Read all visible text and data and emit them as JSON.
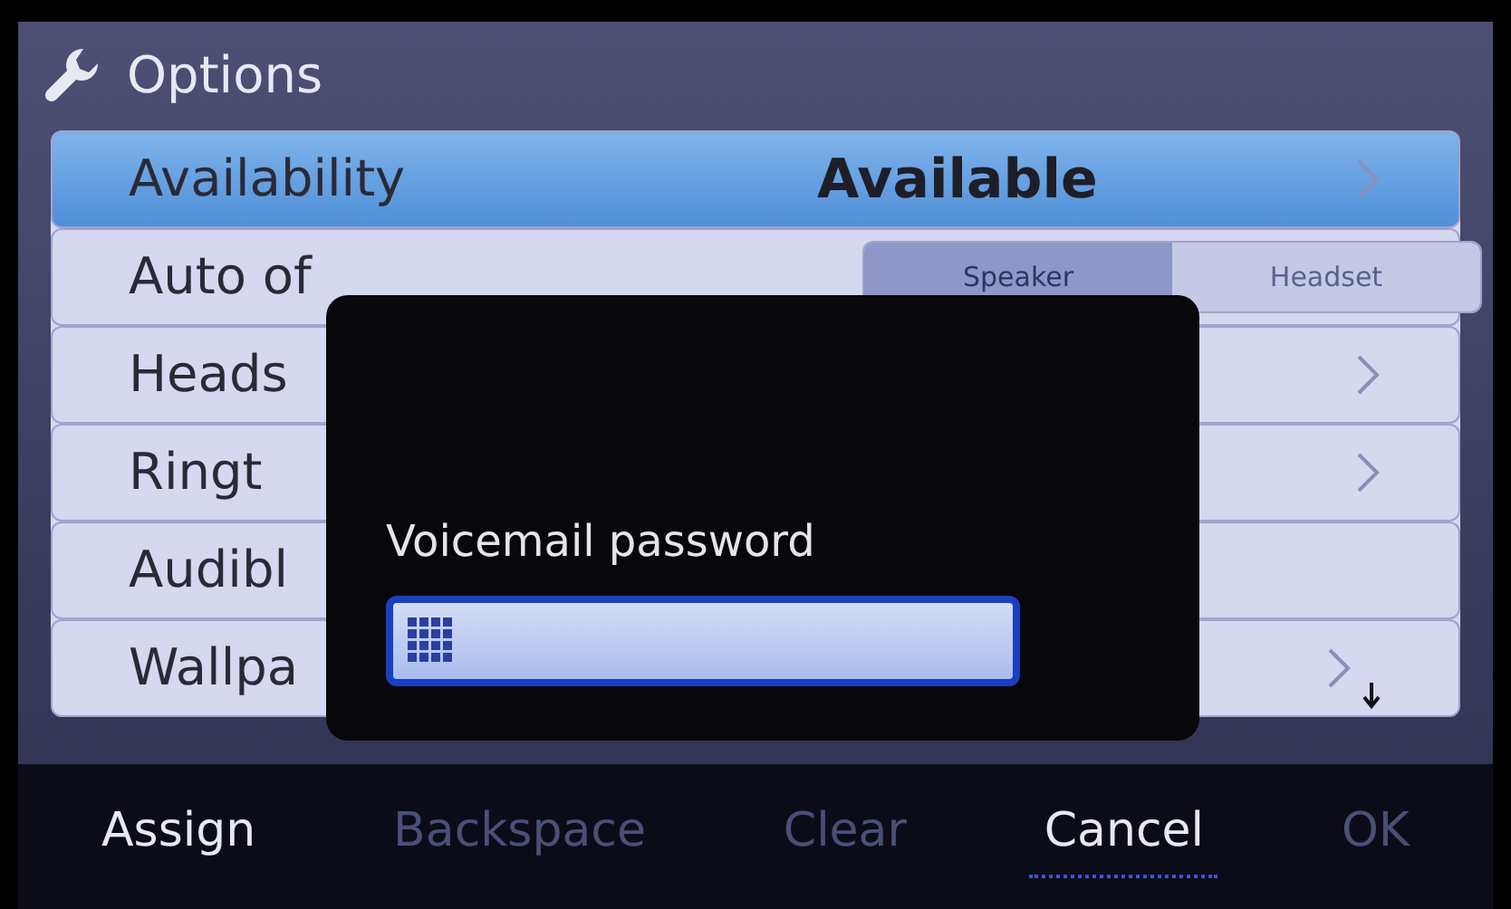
{
  "title": "Options",
  "rows": [
    {
      "label": "Availability",
      "kind": "chevron",
      "value": "Available",
      "selected": true
    },
    {
      "label": "Auto of",
      "kind": "toggle",
      "options": [
        {
          "label": "Speaker",
          "selected": true
        },
        {
          "label": "Headset",
          "selected": false
        }
      ],
      "selected": false
    },
    {
      "label": "Heads",
      "kind": "chevron",
      "selected": false
    },
    {
      "label": "Ringt",
      "kind": "chevron",
      "selected": false
    },
    {
      "label": "Audibl",
      "kind": "plain",
      "selected": false
    },
    {
      "label": "Wallpa",
      "kind": "chevron",
      "selected": false,
      "more_below": true
    }
  ],
  "dialog": {
    "label": "Voicemail password"
  },
  "softkeys": [
    {
      "label": "Assign",
      "disabled": false,
      "selected": false
    },
    {
      "label": "Backspace",
      "disabled": true,
      "selected": false
    },
    {
      "label": "Clear",
      "disabled": true,
      "selected": false
    },
    {
      "label": "Cancel",
      "disabled": false,
      "selected": true
    },
    {
      "label": "OK",
      "disabled": true,
      "selected": false
    }
  ]
}
